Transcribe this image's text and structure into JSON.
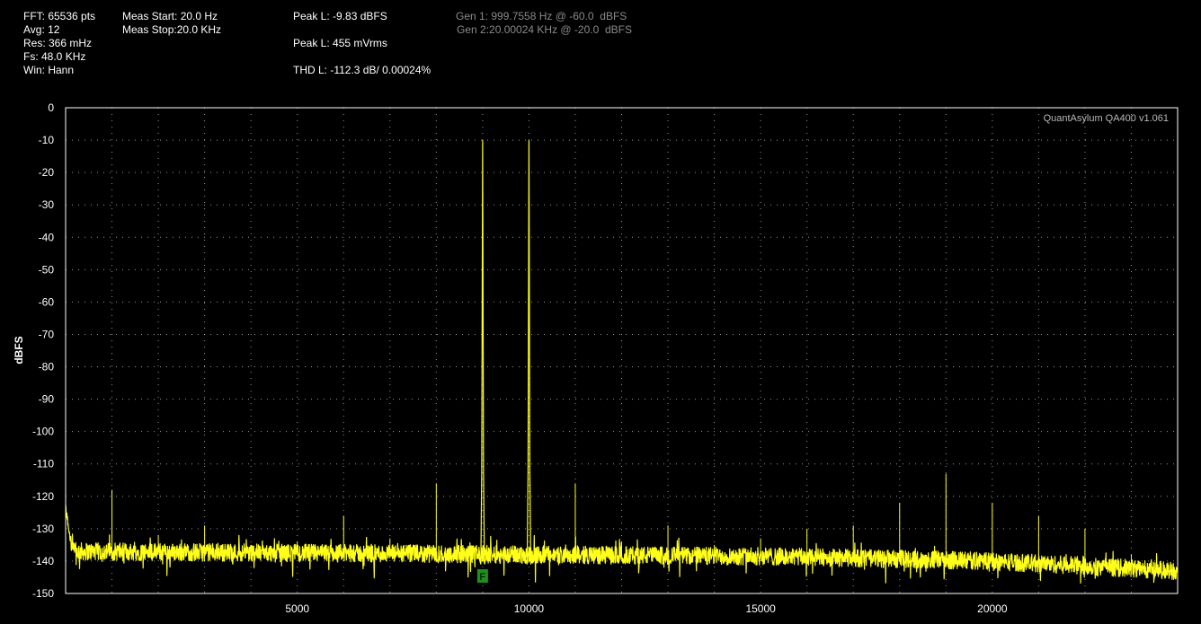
{
  "info": {
    "fft": "FFT: 65536 pts",
    "avg": "Avg: 12",
    "res": "Res: 366 mHz",
    "fs": "Fs: 48.0 KHz",
    "win": "Win: Hann",
    "meas_start": "Meas Start: 20.0 Hz",
    "meas_stop": "Meas Stop:20.0 KHz",
    "peak_dbfs": "Peak L: -9.83 dBFS",
    "peak_vrms": "Peak L: 455 mVrms",
    "thd": "THD L: -112.3 dB/ 0.00024%",
    "gen1": "Gen 1: 999.7558 Hz @ -60.0  dBFS",
    "gen2": "Gen 2:20.00024 KHz @ -20.0  dBFS"
  },
  "watermark": "QuantAsylum QA400 v1.061",
  "marker_label": "F",
  "colors": {
    "background": "#000000",
    "trace": "#ffff1a",
    "grid": "#d8d8d8",
    "frame": "#ffffff",
    "marker": "#1f8f1f"
  },
  "chart_data": {
    "type": "line",
    "xlabel": "",
    "ylabel": "dBFS",
    "xlim": [
      0,
      24000
    ],
    "ylim": [
      -150,
      0
    ],
    "x_ticks": [
      5000,
      10000,
      15000,
      20000
    ],
    "x_tick_labels": [
      "5000",
      "10000",
      "15000",
      "20000"
    ],
    "y_ticks": [
      0,
      -10,
      -20,
      -30,
      -40,
      -50,
      -60,
      -70,
      -80,
      -90,
      -100,
      -110,
      -120,
      -130,
      -140,
      -150
    ],
    "y_tick_labels": [
      "0",
      "-10",
      "-20",
      "-30",
      "-40",
      "-50",
      "-60",
      "-70",
      "-80",
      "-90",
      "-100",
      "-110",
      "-120",
      "-130",
      "-140",
      "-150"
    ],
    "grid": true,
    "noise_floor": [
      {
        "x": 0,
        "y": -137
      },
      {
        "x": 5000,
        "y": -137.5
      },
      {
        "x": 10000,
        "y": -138
      },
      {
        "x": 15000,
        "y": -138.5
      },
      {
        "x": 20000,
        "y": -140
      },
      {
        "x": 24000,
        "y": -143
      }
    ],
    "peaks": [
      {
        "x": 9000,
        "y": -10,
        "main": true
      },
      {
        "x": 10000,
        "y": -10,
        "main": true
      },
      {
        "x": 1000,
        "y": -118
      },
      {
        "x": 2000,
        "y": -132
      },
      {
        "x": 3000,
        "y": -129
      },
      {
        "x": 4000,
        "y": -135
      },
      {
        "x": 5000,
        "y": -134
      },
      {
        "x": 6000,
        "y": -126
      },
      {
        "x": 7000,
        "y": -133
      },
      {
        "x": 8000,
        "y": -116
      },
      {
        "x": 11000,
        "y": -116
      },
      {
        "x": 12000,
        "y": -134
      },
      {
        "x": 13000,
        "y": -129
      },
      {
        "x": 14000,
        "y": -135
      },
      {
        "x": 15000,
        "y": -133
      },
      {
        "x": 16000,
        "y": -130
      },
      {
        "x": 17000,
        "y": -129
      },
      {
        "x": 18000,
        "y": -122
      },
      {
        "x": 19000,
        "y": -113
      },
      {
        "x": 20000,
        "y": -122
      },
      {
        "x": 21000,
        "y": -126
      },
      {
        "x": 22000,
        "y": -130
      },
      {
        "x": 23000,
        "y": -138
      }
    ],
    "marker": {
      "x": 9000
    }
  }
}
